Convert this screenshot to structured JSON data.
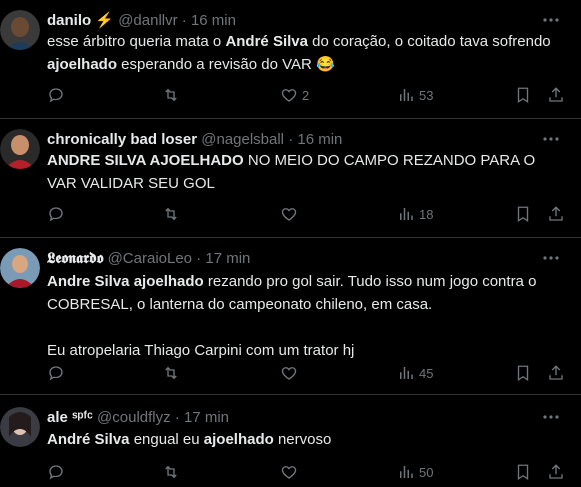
{
  "tweets": [
    {
      "name": "danilo ⚡",
      "handle": "@danllvr",
      "sep": "·",
      "time": "16 min",
      "text_parts": [
        {
          "t": "esse árbitro queria mata o ",
          "b": false
        },
        {
          "t": "André Silva",
          "b": true
        },
        {
          "t": " do coração, o coitado tava sofrendo ",
          "b": false
        },
        {
          "t": "ajoelhado",
          "b": true
        },
        {
          "t": " esperando a revisão do VAR 😂",
          "b": false
        }
      ],
      "likes": "2",
      "views": "53"
    },
    {
      "name": "chronically bad loser",
      "handle": "@nagelsball",
      "sep": "·",
      "time": "16 min",
      "text_parts": [
        {
          "t": "ANDRE SILVA AJOELHADO",
          "b": true
        },
        {
          "t": " NO MEIO DO CAMPO REZANDO PARA O VAR VALIDAR SEU GOL",
          "b": false
        }
      ],
      "likes": "",
      "views": "18"
    },
    {
      "name": "𝕷𝖊𝖔𝖓𝖆𝖗𝖉𝖔",
      "handle": "@CaraioLeo",
      "sep": "·",
      "time": "17 min",
      "text_parts": [
        {
          "t": "Andre Silva ajoelhado",
          "b": true
        },
        {
          "t": " rezando pro gol sair. Tudo isso num jogo contra o COBRESAL, o lanterna do campeonato chileno, em casa.\n\nEu atropelaria Thiago Carpini com um trator hj",
          "b": false
        }
      ],
      "likes": "",
      "views": "45"
    },
    {
      "name": "ale ˢᵖᶠᶜ",
      "handle": "@couldflyz",
      "sep": "·",
      "time": "17 min",
      "text_parts": [
        {
          "t": "André Silva",
          "b": true
        },
        {
          "t": " engual eu ",
          "b": false
        },
        {
          "t": "ajoelhado",
          "b": true
        },
        {
          "t": " nervoso",
          "b": false
        }
      ],
      "likes": "",
      "views": "50"
    }
  ],
  "icons": {
    "reply": "reply-icon",
    "retweet": "retweet-icon",
    "like": "heart-icon",
    "views": "views-icon",
    "bookmark": "bookmark-icon",
    "share": "share-icon",
    "more": "more-icon"
  }
}
